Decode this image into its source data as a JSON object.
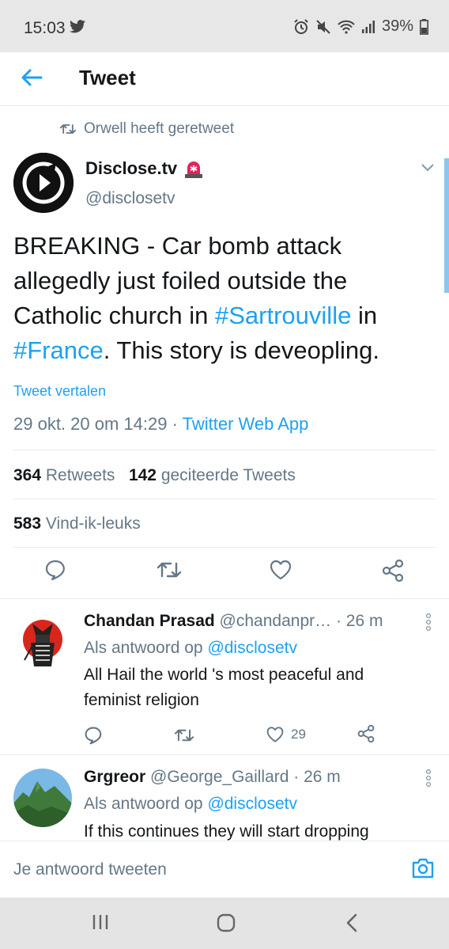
{
  "status_bar": {
    "time": "15:03",
    "battery": "39%"
  },
  "app_bar": {
    "title": "Tweet"
  },
  "tweet": {
    "retweeted_by": "Orwell heeft geretweet",
    "author_name": "Disclose.tv",
    "author_handle": "@disclosetv",
    "text_parts": {
      "p1": "BREAKING - Car bomb attack allegedly just foiled outside the Catholic church in ",
      "h1": "#Sartrouville",
      "p2": " in ",
      "h2": "#France",
      "p3": ". This story is deveopling."
    },
    "translate": "Tweet vertalen",
    "timestamp": "29 okt. 20 om 14:29",
    "dot": " · ",
    "source": "Twitter Web App",
    "retweets_count": "364",
    "retweets_label": " Retweets",
    "quotes_count": "142",
    "quotes_label": " geciteerde Tweets",
    "likes_count": "583",
    "likes_label": " Vind-ik-leuks"
  },
  "replies": [
    {
      "name": "Chandan Prasad",
      "handle": " @chandanpr…",
      "time": " · 26 m",
      "reply_prefix": "Als antwoord op ",
      "reply_to": "@disclosetv",
      "text": "All Hail the world 's most peaceful and feminist religion",
      "likes": "29"
    },
    {
      "name": "Grgreor",
      "handle": " @George_Gaillard",
      "time": " · 26 m",
      "reply_prefix": "Als antwoord op ",
      "reply_to": "@disclosetv",
      "text": "If this continues they will start dropping"
    }
  ],
  "composer": {
    "placeholder": "Je antwoord tweeten"
  },
  "colors": {
    "accent": "#1da1f2",
    "muted": "#657786",
    "text": "#14171a"
  }
}
